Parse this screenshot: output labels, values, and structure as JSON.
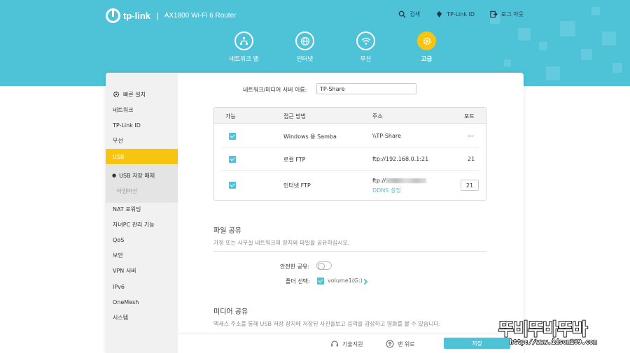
{
  "header": {
    "brand": "tp-link",
    "separator": "|",
    "model": "AX1800 Wi-Fi 6 Router",
    "actions": [
      {
        "label": "검색",
        "icon": "search-icon"
      },
      {
        "label": "TP-Link ID",
        "icon": "user-id-icon"
      },
      {
        "label": "로그 아웃",
        "icon": "logout-icon"
      }
    ],
    "tabs": [
      {
        "label": "네트워크 맵",
        "icon": "network-map-icon"
      },
      {
        "label": "인터넷",
        "icon": "globe-icon"
      },
      {
        "label": "무선",
        "icon": "wifi-icon"
      },
      {
        "label": "고급",
        "icon": "gear-icon",
        "active": true
      }
    ]
  },
  "sidebar": {
    "quick_setup": "빠른 설치",
    "items": [
      "네트워크",
      "TP-Link ID",
      "무선",
      "USB"
    ],
    "sub_items": [
      "USB 저장 매체",
      "타임머신"
    ],
    "items_after": [
      "NAT 포워딩",
      "자녀PC 관리 기능",
      "QoS",
      "보안",
      "VPN 서버",
      "IPv6",
      "OneMesh",
      "시스템"
    ]
  },
  "server": {
    "name_label": "네트워크/미디어 서버 이름:",
    "name_value": "TP-Share"
  },
  "table": {
    "headers": [
      "가능",
      "접근 방법",
      "주소",
      "포트"
    ],
    "rows": [
      {
        "method": "Windows 용 Samba",
        "address": "\\\\TP-Share",
        "port": "---"
      },
      {
        "method": "로컬 FTP",
        "address": "ftp://192.168.0.1:21",
        "port": "21"
      },
      {
        "method": "인터넷 FTP",
        "address": "ftp://",
        "port": "21",
        "link": "DDNS 설정"
      }
    ]
  },
  "file_sharing": {
    "title": "파일 공유",
    "desc": "가정 또는 사무실 네트워크의 장치와 파일을 공유하십시오.",
    "secure_label": "안전한 공유:",
    "folder_label": "폴더 선택:",
    "folder_value": "volume1(G:)"
  },
  "media_sharing": {
    "title": "미디어 공유",
    "desc": "액세스 주소를 통해 USB 저장 장치에 저장된 사진을보고 음악을 감상하고 영화를 볼 수 있습니다."
  },
  "footer": {
    "support": "기술지원",
    "top": "맨 위로",
    "save": "저장"
  },
  "watermark": {
    "title": "뚜비뚜바뚜바",
    "url": "http://www.idsom209.com"
  },
  "colors": {
    "header_bg": "#4ec3d8",
    "accent_yellow": "#f7c510",
    "link": "#4ec3d8"
  }
}
